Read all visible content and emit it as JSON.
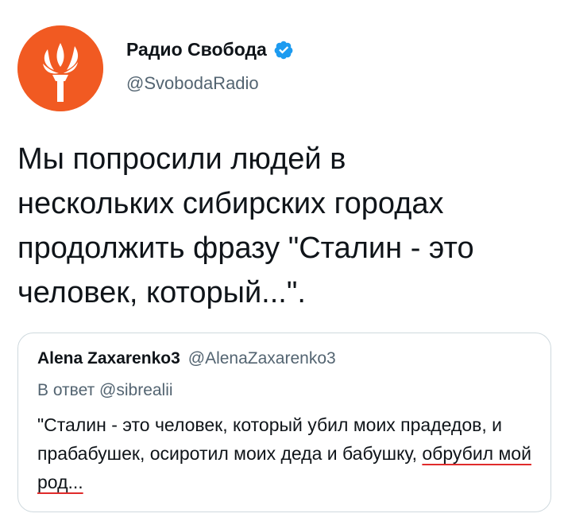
{
  "tweet": {
    "author": {
      "display_name": "Радио Свобода",
      "handle": "@SvobodaRadio",
      "verified": true,
      "avatar_icon": "radio-svoboda-torch-logo",
      "avatar_color": "#f15a22"
    },
    "text": "Мы попросили людей в\nнескольких сибирских городах\nпродолжить фразу \"Сталин - это\nчеловек, который...\"."
  },
  "quoted_tweet": {
    "author_name": "Alena Zaxarenko3",
    "author_handle": "@AlenaZaxarenko3",
    "reply_to": "В ответ @sibrealii",
    "text_main": "\"Сталин - это человек, который убил моих прадедов, и прабабушек, осиротил моих деда и бабушку, ",
    "text_underlined": "обрубил мой род...",
    "underline_color": "#e02b2b"
  },
  "colors": {
    "verified_badge": "#1d9bf0",
    "secondary_text": "#536471",
    "border": "#cfd9de"
  }
}
